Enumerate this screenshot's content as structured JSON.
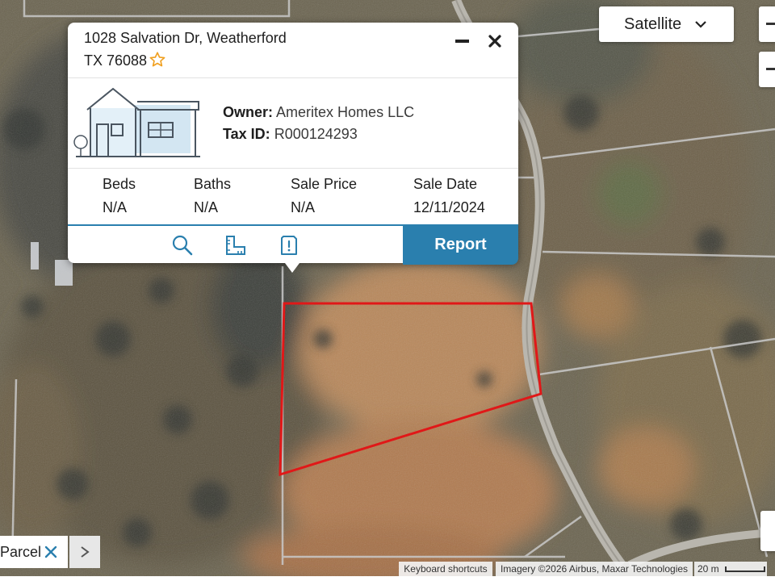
{
  "map": {
    "type_label": "Satellite",
    "parcel_color": "#e01818"
  },
  "popup": {
    "address_line1": "1028 Salvation Dr, Weatherford",
    "address_line2": "TX 76088",
    "owner_label": "Owner:",
    "owner_value": "Ameritex Homes LLC",
    "taxid_label": "Tax ID:",
    "taxid_value": "R000124293",
    "stats": [
      {
        "label": "Beds",
        "value": "N/A"
      },
      {
        "label": "Baths",
        "value": "N/A"
      },
      {
        "label": "Sale Price",
        "value": "N/A"
      },
      {
        "label": "Sale Date",
        "value": "12/11/2024"
      }
    ],
    "report_label": "Report",
    "accent_color": "#2a7fae",
    "star_color": "#f0a020",
    "icons": [
      "minimize-icon",
      "close-icon",
      "house-illustration",
      "search-icon",
      "ruler-icon",
      "info-icon"
    ]
  },
  "parcel_tag": {
    "label": "Parcel"
  },
  "attribution": {
    "shortcuts": "Keyboard shortcuts",
    "imagery": "Imagery ©2026 Airbus, Maxar Technologies",
    "scale": "20 m"
  }
}
